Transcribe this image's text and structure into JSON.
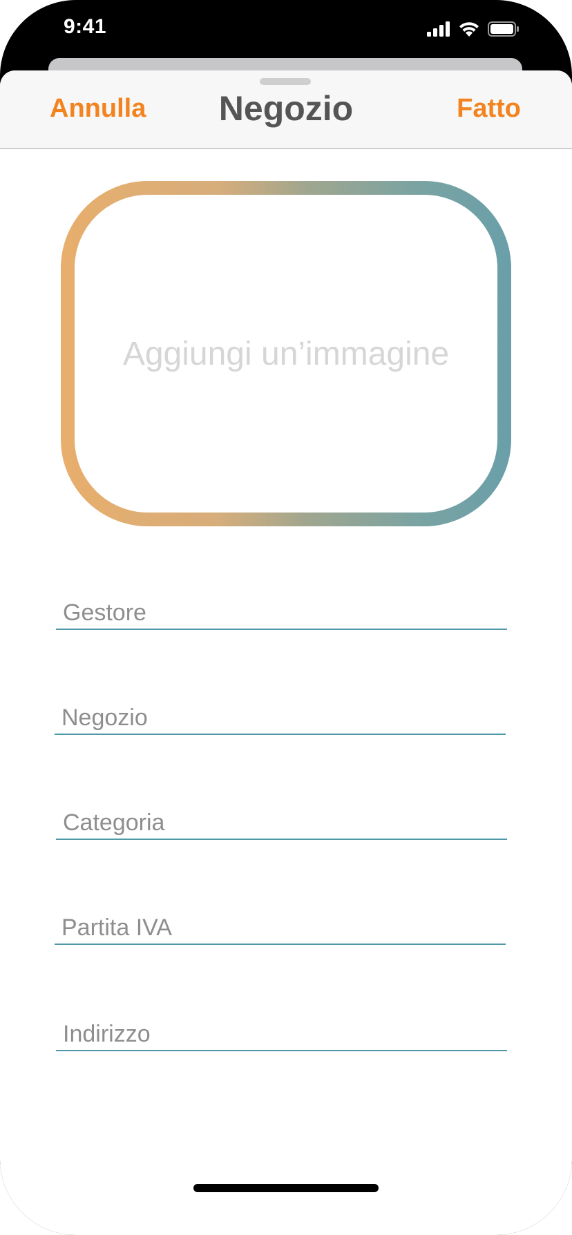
{
  "status_bar": {
    "time": "9:41",
    "icons": [
      "cellular-signal-icon",
      "wifi-icon",
      "battery-icon"
    ]
  },
  "nav": {
    "cancel_label": "Annulla",
    "title": "Negozio",
    "done_label": "Fatto"
  },
  "image_picker": {
    "label": "Aggiungi un’immagine"
  },
  "form": {
    "fields": [
      {
        "name": "gestore",
        "placeholder": "Gestore",
        "value": ""
      },
      {
        "name": "negozio",
        "placeholder": "Negozio",
        "value": ""
      },
      {
        "name": "categoria",
        "placeholder": "Categoria",
        "value": ""
      },
      {
        "name": "partita-iva",
        "placeholder": "Partita IVA",
        "value": ""
      },
      {
        "name": "indirizzo",
        "placeholder": "Indirizzo",
        "value": ""
      }
    ]
  },
  "colors": {
    "accent": "#f2831e",
    "title": "#555555",
    "field_underline": "#4f98a8",
    "gradient_start": "#e8ae6c",
    "gradient_end": "#6a9fa9"
  }
}
